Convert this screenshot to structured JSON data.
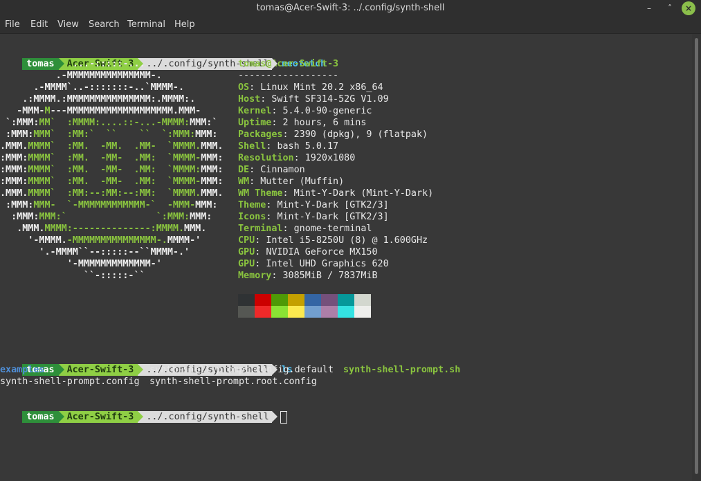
{
  "window": {
    "title": "tomas@Acer-Swift-3: ../.config/synth-shell",
    "minimize_glyph": "–",
    "maximize_glyph": "˄",
    "close_glyph": "×"
  },
  "menu": [
    "File",
    "Edit",
    "View",
    "Search",
    "Terminal",
    "Help"
  ],
  "prompt": {
    "user": "tomas",
    "host": "Acer-Swift-3",
    "path": "../.config/synth-shell"
  },
  "commands": [
    "neofetch",
    "ls"
  ],
  "neofetch": {
    "art": [
      [
        [
          "w",
          "             ...-:::::-..."
        ]
      ],
      [
        [
          "w",
          "          .-MMMMMMMMMMMMMMM-."
        ]
      ],
      [
        [
          "w",
          "      .-MMMM`..-:::::::-..`MMMM-."
        ]
      ],
      [
        [
          "w",
          "    .:MMMM.:MMMMMMMMMMMMMMM:.MMMM:."
        ]
      ],
      [
        [
          "w",
          "   -MMM-"
        ],
        [
          "g",
          "M"
        ],
        [
          "w",
          "---MMMMMMMMMMMMMMMMMMM.MMM-"
        ]
      ],
      [
        [
          "w",
          " `:MMM:"
        ],
        [
          "g",
          "MM`  :MMMM:....::-...-MMMM:"
        ],
        [
          "w",
          "MMM:`"
        ]
      ],
      [
        [
          "w",
          " :MMM:"
        ],
        [
          "g",
          "MMM`  :MM:`  ``    ``  `:MMM:"
        ],
        [
          "w",
          "MMM:"
        ]
      ],
      [
        [
          "w",
          ".MMM."
        ],
        [
          "g",
          "MMMM`  :MM.  -MM.  .MM-  `MMMM."
        ],
        [
          "w",
          "MMM."
        ]
      ],
      [
        [
          "w",
          ":MMM:"
        ],
        [
          "g",
          "MMMM`  :MM.  -MM-  .MM:  `MMMM-"
        ],
        [
          "w",
          "MMM:"
        ]
      ],
      [
        [
          "w",
          ":MMM:"
        ],
        [
          "g",
          "MMMM`  :MM.  -MM-  .MM:  `MMMM:"
        ],
        [
          "w",
          "MMM:"
        ]
      ],
      [
        [
          "w",
          ":MMM:"
        ],
        [
          "g",
          "MMMM`  :MM.  -MM-  .MM:  `MMMM-"
        ],
        [
          "w",
          "MMM:"
        ]
      ],
      [
        [
          "w",
          ".MMM."
        ],
        [
          "g",
          "MMMM`  :MM:--:MM:--:MM:  `MMMM."
        ],
        [
          "w",
          "MMM."
        ]
      ],
      [
        [
          "w",
          " :MMM:"
        ],
        [
          "g",
          "MMM-  `-MMMMMMMMMMMM-`  -MMM-"
        ],
        [
          "w",
          "MMM:"
        ]
      ],
      [
        [
          "w",
          "  :MMM:"
        ],
        [
          "g",
          "MMM:`                `:MMM:"
        ],
        [
          "w",
          "MMM:"
        ]
      ],
      [
        [
          "w",
          "   .MMM."
        ],
        [
          "g",
          "MMMM:--------------:MMMM."
        ],
        [
          "w",
          "MMM."
        ]
      ],
      [
        [
          "w",
          "     '-MMMM."
        ],
        [
          "g",
          "-MMMMMMMMMMMMMMM-."
        ],
        [
          "w",
          "MMMM-'"
        ]
      ],
      [
        [
          "w",
          "       '.-MMMM``--:::::--``MMMM-.'"
        ]
      ],
      [
        [
          "w",
          "            '-MMMMMMMMMMMMM-'"
        ]
      ],
      [
        [
          "w",
          "               ``-:::::-``"
        ]
      ]
    ],
    "header": "tomas@Acer-Swift-3",
    "separator": "------------------",
    "info": [
      {
        "k": "OS",
        "v": "Linux Mint 20.2 x86_64"
      },
      {
        "k": "Host",
        "v": "Swift SF314-52G V1.09"
      },
      {
        "k": "Kernel",
        "v": "5.4.0-90-generic"
      },
      {
        "k": "Uptime",
        "v": "2 hours, 6 mins"
      },
      {
        "k": "Packages",
        "v": "2390 (dpkg), 9 (flatpak)"
      },
      {
        "k": "Shell",
        "v": "bash 5.0.17"
      },
      {
        "k": "Resolution",
        "v": "1920x1080"
      },
      {
        "k": "DE",
        "v": "Cinnamon"
      },
      {
        "k": "WM",
        "v": "Mutter (Muffin)"
      },
      {
        "k": "WM Theme",
        "v": "Mint-Y-Dark (Mint-Y-Dark)"
      },
      {
        "k": "Theme",
        "v": "Mint-Y-Dark [GTK2/3]"
      },
      {
        "k": "Icons",
        "v": "Mint-Y-Dark [GTK2/3]"
      },
      {
        "k": "Terminal",
        "v": "gnome-terminal"
      },
      {
        "k": "CPU",
        "v": "Intel i5-8250U (8) @ 1.600GHz"
      },
      {
        "k": "GPU",
        "v": "NVIDIA GeForce MX150"
      },
      {
        "k": "GPU",
        "v": "Intel UHD Graphics 620"
      },
      {
        "k": "Memory",
        "v": "3085MiB / 7837MiB"
      }
    ],
    "palette_top": [
      "#2f3234",
      "#cc0000",
      "#4e9a06",
      "#c4a000",
      "#3465a4",
      "#75507b",
      "#06989a",
      "#d3d7cf"
    ],
    "palette_bottom": [
      "#555753",
      "#ef2929",
      "#8ae234",
      "#fce94f",
      "#729fcf",
      "#ad7fa8",
      "#34e2e2",
      "#eeeeec"
    ]
  },
  "ls": {
    "row1": [
      {
        "text": "examples",
        "type": "dir"
      },
      {
        "text": "synth-shell-prompt.config.default",
        "type": "file"
      },
      {
        "text": "synth-shell-prompt.sh",
        "type": "exe"
      }
    ],
    "row2": [
      {
        "text": "synth-shell-prompt.config",
        "type": "file"
      },
      {
        "text": "synth-shell-prompt.root.config",
        "type": "file"
      }
    ]
  }
}
